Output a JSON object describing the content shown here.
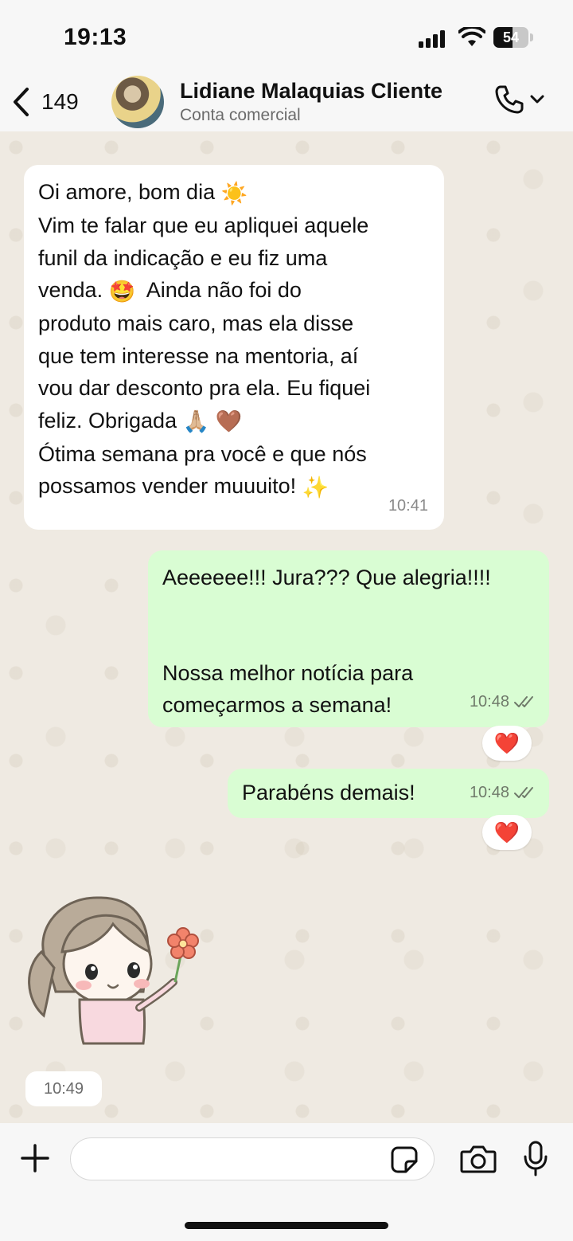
{
  "status_bar": {
    "time": "19:13",
    "battery_level": "54",
    "battery_fraction": 0.54
  },
  "header": {
    "back_count": "149",
    "contact_name": "Lidiane Malaquias Cliente",
    "contact_subtitle": "Conta comercial",
    "icons": [
      "chevron-left-icon",
      "phone-icon",
      "chevron-down-icon"
    ]
  },
  "messages": {
    "incoming_1": {
      "lines": [
        "Oi amore, bom dia",
        "Vim te falar que eu apliquei aquele",
        "funil da indicação e eu fiz uma",
        "venda.",
        "Ainda não foi do",
        "produto mais caro, mas ela disse",
        "que tem interesse na mentoria, aí",
        "vou dar desconto pra ela. Eu fiquei",
        "feliz. Obrigada",
        "Ótima semana pra você e que nós",
        "possamos vender muuuito!"
      ],
      "emojis": [
        "☀️",
        "🤩",
        "🙏🏼",
        "🤎",
        "✨"
      ],
      "time": "10:41"
    },
    "outgoing_1": {
      "line_1": "Aeeeeee!!! Jura??? Que alegria!!!!",
      "line_2": "Nossa melhor notícia para",
      "line_3": "começarmos a semana!",
      "time": "10:48",
      "reaction": "❤️"
    },
    "outgoing_2": {
      "text": "Parabéns demais!",
      "time": "10:48",
      "reaction": "❤️"
    },
    "sticker": {
      "time": "10:49"
    }
  },
  "input_bar": {
    "placeholder": "",
    "icons": [
      "plus-icon",
      "sticker-icon",
      "camera-icon",
      "microphone-icon"
    ]
  },
  "colors": {
    "incoming_bubble": "#ffffff",
    "outgoing_bubble": "#d9fdd3",
    "chat_background": "#efeae2",
    "read_ticks": "#6f7a6a",
    "reaction_heart": "#e0182d"
  }
}
